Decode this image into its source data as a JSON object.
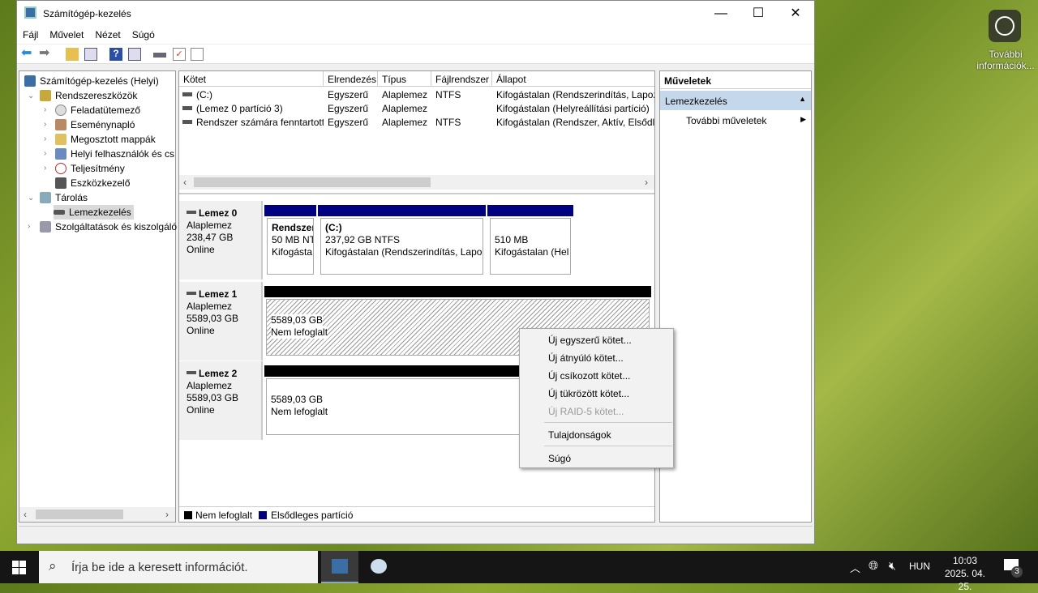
{
  "window": {
    "title": "Számítógép-kezelés",
    "min": "—",
    "max": "☐",
    "close": "✕"
  },
  "menu": [
    "Fájl",
    "Művelet",
    "Nézet",
    "Súgó"
  ],
  "tree": {
    "root": "Számítógép-kezelés (Helyi)",
    "items": [
      "Rendszereszközök",
      "Feladatütemező",
      "Eseménynapló",
      "Megosztott mappák",
      "Helyi felhasználók és cs",
      "Teljesítmény",
      "Eszközkezelő",
      "Tárolás",
      "Lemezkezelés",
      "Szolgáltatások és kiszolgáló"
    ]
  },
  "volumes": {
    "headers": [
      "Kötet",
      "Elrendezés",
      "Típus",
      "Fájlrendszer",
      "Állapot"
    ],
    "rows": [
      [
        "(C:)",
        "Egyszerű",
        "Alaplemez",
        "NTFS",
        "Kifogástalan (Rendszerindítás, Lapozó"
      ],
      [
        "(Lemez 0 partíció 3)",
        "Egyszerű",
        "Alaplemez",
        "",
        "Kifogástalan (Helyreállítási partíció)"
      ],
      [
        "Rendszer számára fenntartott",
        "Egyszerű",
        "Alaplemez",
        "NTFS",
        "Kifogástalan (Rendszer, Aktív, Elsődle"
      ]
    ]
  },
  "disks": [
    {
      "name": "Lemez 0",
      "type": "Alaplemez",
      "size": "238,47 GB",
      "status": "Online",
      "parts": [
        {
          "name": "Rendszer",
          "size": "50 MB NT",
          "status": "Kifogásta"
        },
        {
          "name": "(C:)",
          "size": "237,92 GB NTFS",
          "status": "Kifogástalan (Rendszerindítás, Lapozó"
        },
        {
          "name": "",
          "size": "510 MB",
          "status": "Kifogástalan (Hel"
        }
      ]
    },
    {
      "name": "Lemez 1",
      "type": "Alaplemez",
      "size": "5589,03 GB",
      "status": "Online",
      "parts": [
        {
          "size": "5589,03 GB",
          "status": "Nem lefoglalt"
        }
      ]
    },
    {
      "name": "Lemez 2",
      "type": "Alaplemez",
      "size": "5589,03 GB",
      "status": "Online",
      "parts": [
        {
          "size": "5589,03 GB",
          "status": "Nem lefoglalt"
        }
      ]
    }
  ],
  "legend": [
    "Nem lefoglalt",
    "Elsődleges partíció"
  ],
  "colors": {
    "unallocated": "#000000",
    "primary": "#000080"
  },
  "actions": {
    "title": "Műveletek",
    "section": "Lemezkezelés",
    "more": "További műveletek"
  },
  "context_menu": {
    "items": [
      "Új egyszerű kötet...",
      "Új átnyúló kötet...",
      "Új csíkozott kötet...",
      "Új tükrözött kötet...",
      "Új RAID-5 kötet..."
    ],
    "properties": "Tulajdonságok",
    "help": "Súgó"
  },
  "desktop": {
    "info_label": "További információk..."
  },
  "taskbar": {
    "search_placeholder": "Írja be ide a keresett információt.",
    "lang": "HUN",
    "time": "10:03",
    "date": "2025. 04. 25.",
    "notifications": "3"
  }
}
